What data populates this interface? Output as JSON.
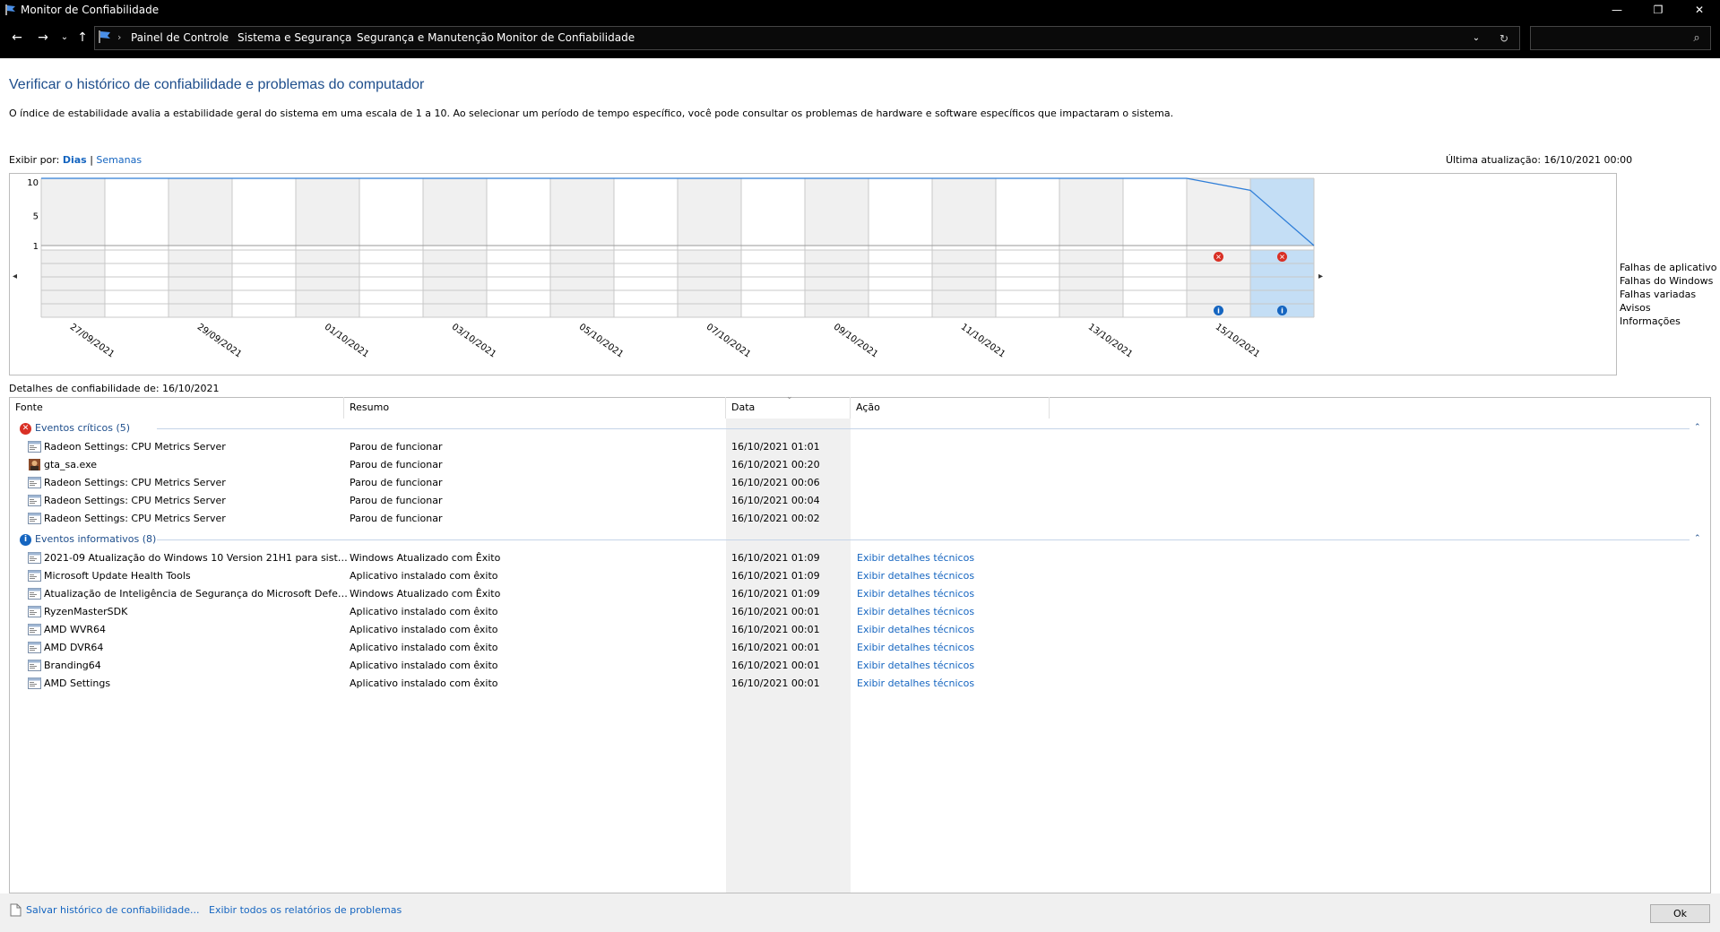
{
  "window": {
    "title": "Monitor de Confiabilidade",
    "minimize_glyph": "—",
    "maximize_glyph": "❐",
    "close_glyph": "✕"
  },
  "nav": {
    "back_glyph": "←",
    "forward_glyph": "→",
    "recent_glyph": "⌄",
    "up_glyph": "↑",
    "dropdown_glyph": "⌄",
    "refresh_glyph": "↻",
    "search_glyph": "⌕",
    "breadcrumb": [
      "Painel de Controle",
      "Sistema e Segurança",
      "Segurança e Manutenção",
      "Monitor de Confiabilidade"
    ],
    "separator": "›",
    "search_placeholder": ""
  },
  "header": {
    "title": "Verificar o histórico de confiabilidade e problemas do computador",
    "description": "O índice de estabilidade avalia a estabilidade geral do sistema em uma escala de 1 a 10. Ao selecionar um período de tempo específico, você pode consultar os problemas de hardware e software específicos que impactaram o sistema."
  },
  "view_by": {
    "label": "Exibir por:",
    "days": "Dias",
    "separator": "|",
    "weeks": "Semanas"
  },
  "last_update": "Última atualização: 16/10/2021 00:00",
  "chart_data": {
    "type": "line",
    "title": "",
    "ylim": [
      1,
      10
    ],
    "y_ticks": [
      "10",
      "5",
      "1"
    ],
    "date_labels": [
      "27/09/2021",
      "29/09/2021",
      "01/10/2021",
      "03/10/2021",
      "05/10/2021",
      "07/10/2021",
      "09/10/2021",
      "11/10/2021",
      "13/10/2021",
      "15/10/2021"
    ],
    "days": 20,
    "selected_day": 19,
    "stability_index": {
      "start_day": 0,
      "values": [
        10,
        10,
        10,
        10,
        10,
        10,
        10,
        10,
        10,
        10,
        10,
        10,
        10,
        10,
        10,
        10,
        10,
        10,
        10,
        8.4,
        1
      ]
    },
    "category_rows": [
      "Falhas de aplicativo",
      "Falhas do Windows",
      "Falhas variadas",
      "Avisos",
      "Informações"
    ],
    "markers": [
      {
        "row": 0,
        "day": 18,
        "kind": "error"
      },
      {
        "row": 0,
        "day": 19,
        "kind": "error"
      },
      {
        "row": 4,
        "day": 18,
        "kind": "info"
      },
      {
        "row": 4,
        "day": 19,
        "kind": "info"
      }
    ],
    "scroll_left_glyph": "◂",
    "scroll_right_glyph": "▸",
    "colors": {
      "line": "#2f7ed8",
      "selected": "#c4def5",
      "shade": "#f0f0f0",
      "grid": "#c8c8c8"
    }
  },
  "details": {
    "label": "Detalhes de confiabilidade de: 16/10/2021",
    "columns": {
      "source": "Fonte",
      "summary": "Resumo",
      "date": "Data",
      "action": "Ação"
    },
    "sort_glyph": "⌄",
    "critical": {
      "header": "Eventos críticos (5)",
      "collapse_glyph": "⌃",
      "rows": [
        {
          "source": "Radeon Settings: CPU Metrics Server",
          "summary": "Parou de funcionar",
          "date": "16/10/2021 01:01",
          "action": "",
          "icon": "app-window-icon"
        },
        {
          "source": "gta_sa.exe",
          "summary": "Parou de funcionar",
          "date": "16/10/2021 00:20",
          "action": "",
          "icon": "game-icon"
        },
        {
          "source": "Radeon Settings: CPU Metrics Server",
          "summary": "Parou de funcionar",
          "date": "16/10/2021 00:06",
          "action": "",
          "icon": "app-window-icon"
        },
        {
          "source": "Radeon Settings: CPU Metrics Server",
          "summary": "Parou de funcionar",
          "date": "16/10/2021 00:04",
          "action": "",
          "icon": "app-window-icon"
        },
        {
          "source": "Radeon Settings: CPU Metrics Server",
          "summary": "Parou de funcionar",
          "date": "16/10/2021 00:02",
          "action": "",
          "icon": "app-window-icon"
        }
      ]
    },
    "informational": {
      "header": "Eventos informativos (8)",
      "collapse_glyph": "⌃",
      "rows": [
        {
          "source": "2021-09 Atualização do Windows 10 Version 21H1 para sistem...",
          "summary": "Windows Atualizado com Êxito",
          "date": "16/10/2021 01:09",
          "action": "Exibir detalhes técnicos",
          "icon": "app-window-icon"
        },
        {
          "source": "Microsoft Update Health Tools",
          "summary": "Aplicativo instalado com êxito",
          "date": "16/10/2021 01:09",
          "action": "Exibir detalhes técnicos",
          "icon": "app-window-icon"
        },
        {
          "source": "Atualização de Inteligência de Segurança do Microsoft Defen...",
          "summary": "Windows Atualizado com Êxito",
          "date": "16/10/2021 01:09",
          "action": "Exibir detalhes técnicos",
          "icon": "app-window-icon"
        },
        {
          "source": "RyzenMasterSDK",
          "summary": "Aplicativo instalado com êxito",
          "date": "16/10/2021 00:01",
          "action": "Exibir detalhes técnicos",
          "icon": "app-window-icon"
        },
        {
          "source": "AMD WVR64",
          "summary": "Aplicativo instalado com êxito",
          "date": "16/10/2021 00:01",
          "action": "Exibir detalhes técnicos",
          "icon": "app-window-icon"
        },
        {
          "source": "AMD DVR64",
          "summary": "Aplicativo instalado com êxito",
          "date": "16/10/2021 00:01",
          "action": "Exibir detalhes técnicos",
          "icon": "app-window-icon"
        },
        {
          "source": "Branding64",
          "summary": "Aplicativo instalado com êxito",
          "date": "16/10/2021 00:01",
          "action": "Exibir detalhes técnicos",
          "icon": "app-window-icon"
        },
        {
          "source": "AMD Settings",
          "summary": "Aplicativo instalado com êxito",
          "date": "16/10/2021 00:01",
          "action": "Exibir detalhes técnicos",
          "icon": "app-window-icon"
        }
      ]
    }
  },
  "footer": {
    "save_history": "Salvar histórico de confiabilidade...",
    "view_all_reports": "Exibir todos os relatórios de problemas",
    "ok": "Ok"
  },
  "icon_glyphs": {
    "error": "✕",
    "info": "i"
  }
}
